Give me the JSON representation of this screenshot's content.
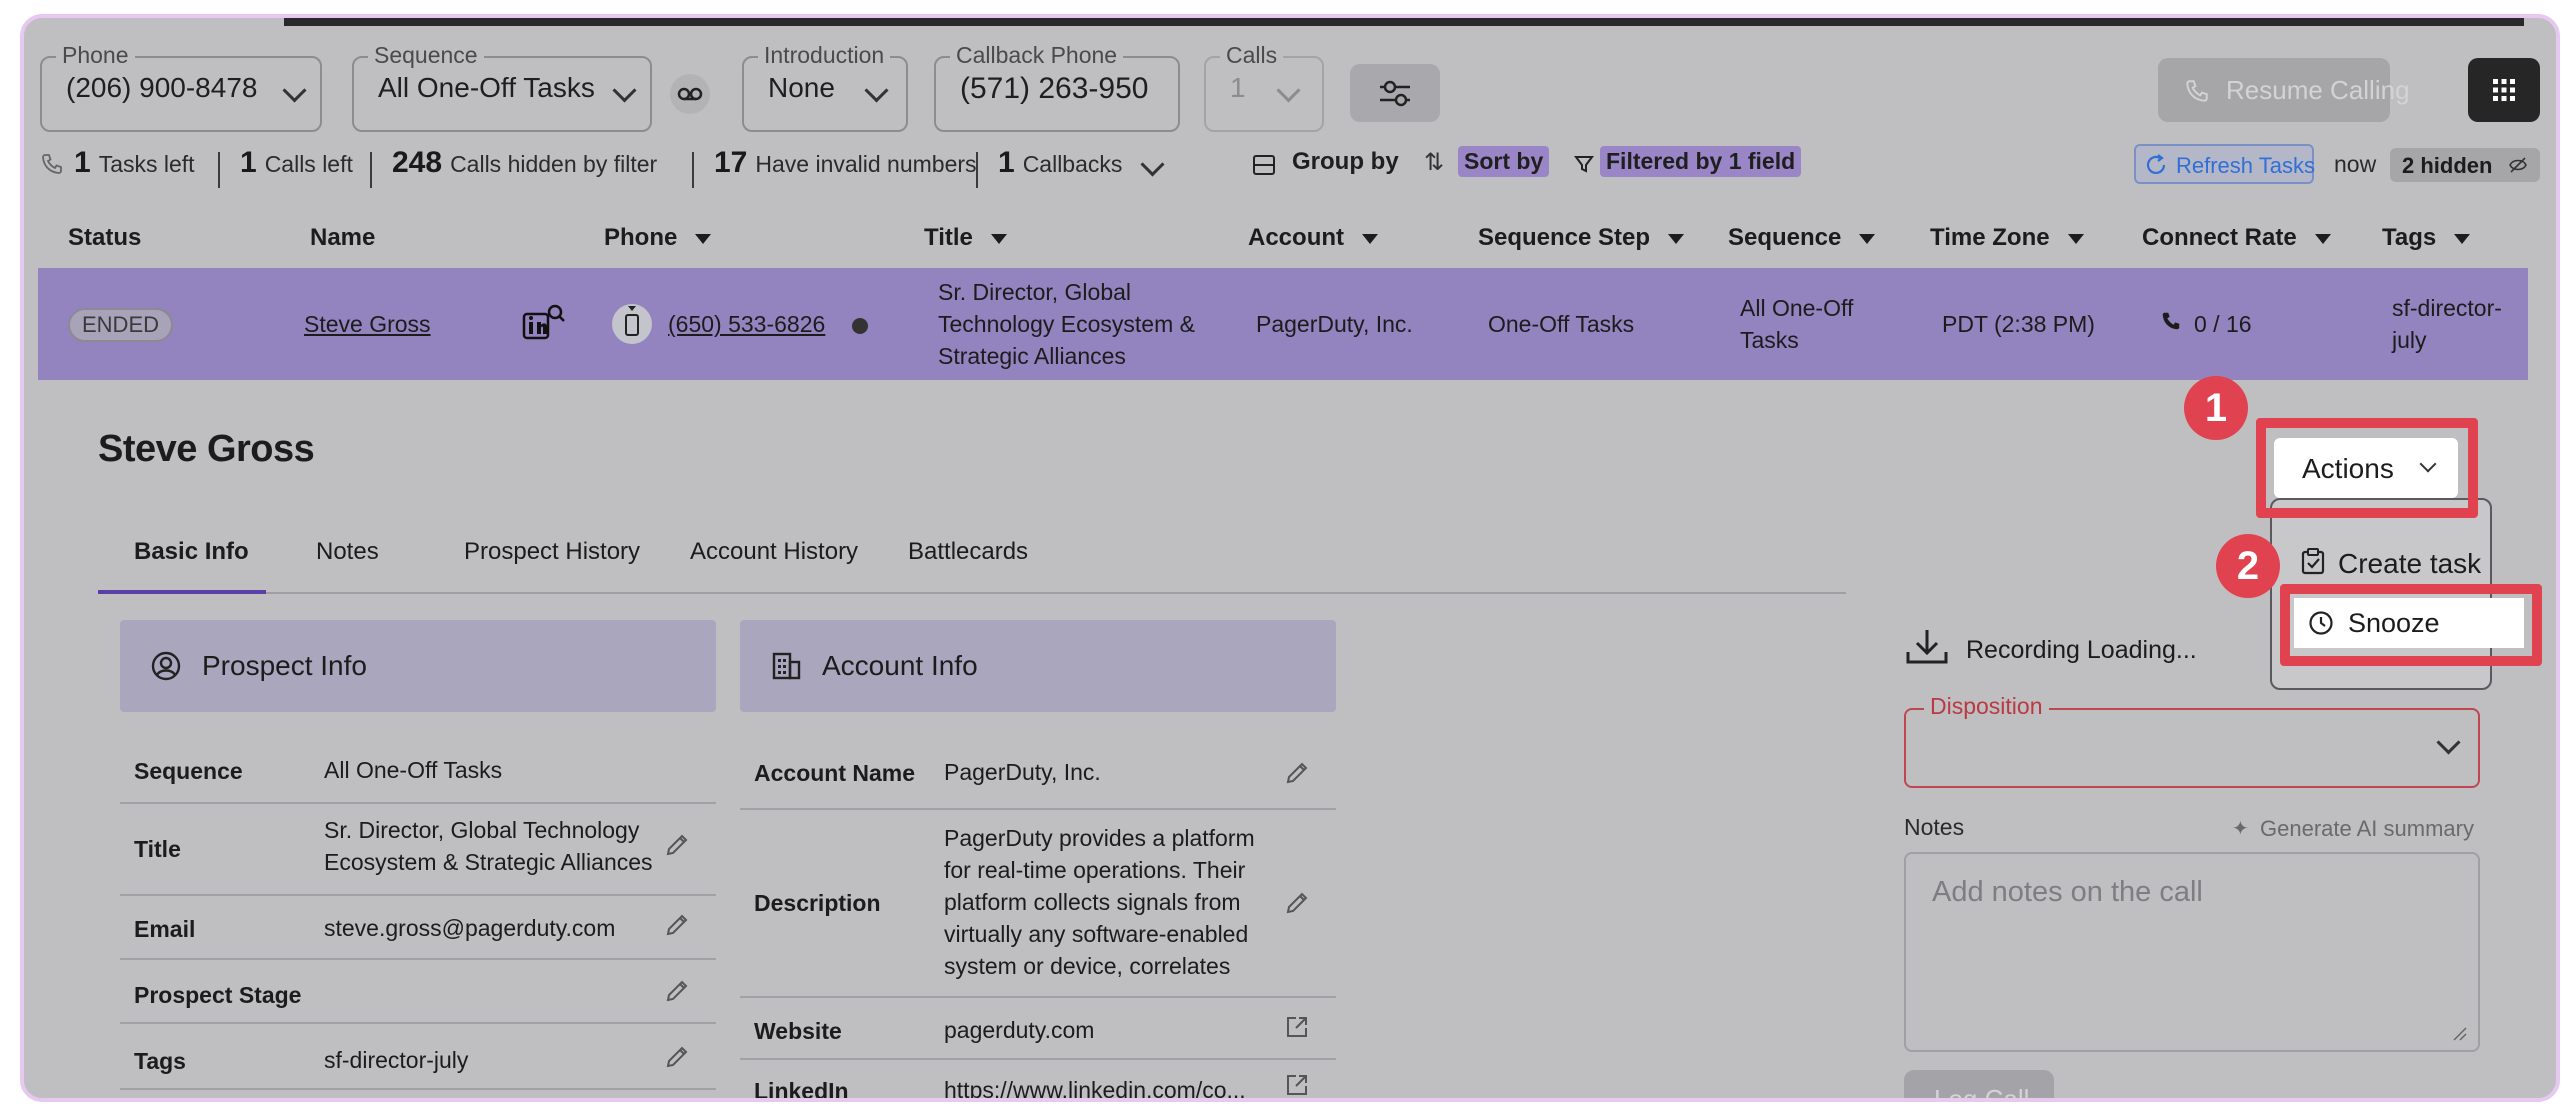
{
  "filters": {
    "phone": {
      "label": "Phone",
      "value": "(206) 900-8478"
    },
    "sequence": {
      "label": "Sequence",
      "value": "All One-Off Tasks"
    },
    "introduction": {
      "label": "Introduction",
      "value": "None"
    },
    "callback_phone": {
      "label": "Callback Phone",
      "value": "(571) 263-950"
    },
    "calls": {
      "label": "Calls",
      "value": "1"
    },
    "resume_calling": "Resume Calling"
  },
  "stats": {
    "tasks_left_count": "1",
    "tasks_left_label": "Tasks left",
    "calls_left_count": "1",
    "calls_left_label": "Calls left",
    "hidden_count": "248",
    "hidden_label": "Calls hidden by filter",
    "invalid_count": "17",
    "invalid_label": "Have invalid numbers",
    "callbacks_count": "1",
    "callbacks_label": "Callbacks",
    "group_by": "Group by",
    "sort_by": "Sort by",
    "filtered": "Filtered by 1 field",
    "refresh": "Refresh Tasks",
    "now": "now",
    "hidden_pill": "2 hidden"
  },
  "table": {
    "columns": [
      "Status",
      "Name",
      "Phone",
      "Title",
      "Account",
      "Sequence Step",
      "Sequence",
      "Time Zone",
      "Connect Rate",
      "Tags"
    ],
    "row": {
      "status": "ENDED",
      "name": "Steve Gross",
      "phone": "(650) 533-6826",
      "title": "Sr. Director, Global Technology Ecosystem & Strategic Alliances",
      "account": "PagerDuty, Inc.",
      "sequence_step": "One-Off Tasks",
      "sequence": "All One-Off Tasks",
      "time_zone": "PDT (2:38 PM)",
      "connect_rate": "0 / 16",
      "tags": "sf-director-july"
    }
  },
  "detail": {
    "name": "Steve Gross",
    "tabs": [
      "Basic Info",
      "Notes",
      "Prospect History",
      "Account History",
      "Battlecards"
    ],
    "prospect_info": {
      "title": "Prospect Info",
      "fields": [
        {
          "label": "Sequence",
          "value": "All One-Off Tasks"
        },
        {
          "label": "Title",
          "value": "Sr. Director, Global Technology Ecosystem & Strategic Alliances"
        },
        {
          "label": "Email",
          "value": "steve.gross@pagerduty.com"
        },
        {
          "label": "Prospect Stage",
          "value": ""
        },
        {
          "label": "Tags",
          "value": "sf-director-july"
        }
      ]
    },
    "account_info": {
      "title": "Account Info",
      "fields": [
        {
          "label": "Account Name",
          "value": "PagerDuty, Inc."
        },
        {
          "label": "Description",
          "value": "PagerDuty provides a platform for real-time operations. Their platform collects signals from virtually any software-enabled system or device, correlates an..."
        },
        {
          "label": "Website",
          "value": "pagerduty.com"
        },
        {
          "label": "LinkedIn",
          "value": "https://www.linkedin.com/co..."
        }
      ]
    }
  },
  "actions": {
    "button": "Actions",
    "menu": [
      "Create task",
      "Snooze"
    ]
  },
  "call_panel": {
    "recording": "Recording Loading...",
    "disposition_label": "Disposition",
    "notes_label": "Notes",
    "generate_ai": "Generate AI summary",
    "notes_placeholder": "Add notes on the call",
    "log_call": "Log Call"
  },
  "annotations": {
    "step1": "1",
    "step2": "2"
  },
  "colors": {
    "accent_row": "#9383bf",
    "annotation": "#e0424f",
    "link_blue": "#2f6fd6"
  }
}
